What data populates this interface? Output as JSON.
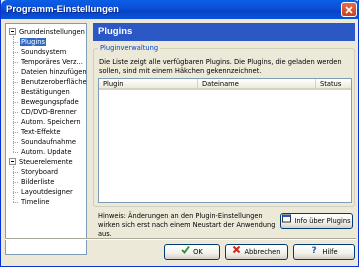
{
  "window": {
    "title": "Programm-Einstellungen"
  },
  "tree": [
    {
      "label": "Grundeinstellungen",
      "level": 0,
      "expandable": true,
      "selected": false
    },
    {
      "label": "Plugins",
      "level": 1,
      "selected": true
    },
    {
      "label": "Soundsystem",
      "level": 1
    },
    {
      "label": "Temporäres Verz...",
      "level": 1
    },
    {
      "label": "Dateien hinzufügen",
      "level": 1
    },
    {
      "label": "Benutzeroberfläche",
      "level": 1
    },
    {
      "label": "Bestätigungen",
      "level": 1
    },
    {
      "label": "Bewegungspfade",
      "level": 1
    },
    {
      "label": "CD/DVD-Brenner",
      "level": 1
    },
    {
      "label": "Autom. Speichern",
      "level": 1
    },
    {
      "label": "Text-Effekte",
      "level": 1
    },
    {
      "label": "Soundaufnahme",
      "level": 1
    },
    {
      "label": "Autom. Update",
      "level": 1
    },
    {
      "label": "Steuerelemente",
      "level": 0,
      "expandable": true
    },
    {
      "label": "Storyboard",
      "level": 1
    },
    {
      "label": "Bilderliste",
      "level": 1
    },
    {
      "label": "Layoutdesigner",
      "level": 1
    },
    {
      "label": "Timeline",
      "level": 1
    }
  ],
  "panel": {
    "title": "Plugins",
    "group_label": "Pluginverwaltung",
    "description": "Die Liste zeigt alle verfügbaren Plugins. Die Plugins, die geladen werden sollen, sind mit einem Häkchen gekennzeichnet.",
    "columns": [
      "Plugin",
      "Dateiname",
      "Status"
    ],
    "rows": [],
    "hint": "Hinweis: Änderungen an den Plugin-Einstellungen wirken sich erst nach einem Neustart der Anwendung aus.",
    "info_button": "Info über Plugins"
  },
  "footer": {
    "ok": "OK",
    "cancel": "Abbrechen",
    "help": "Hilfe"
  },
  "colors": {
    "selection": "#316AC5",
    "header": "#2B58C4",
    "titlebar": "#0A4FD6",
    "group_label": "#0046D5"
  }
}
